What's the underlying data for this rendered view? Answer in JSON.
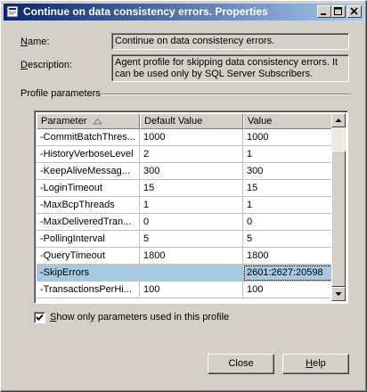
{
  "window": {
    "title": "Continue on data consistency errors. Properties"
  },
  "name": {
    "label_prefix": "N",
    "label_rest": "ame:",
    "value": "Continue on data consistency errors."
  },
  "description": {
    "label_prefix": "D",
    "label_rest": "escription:",
    "value": "Agent profile for skipping data consistency errors. It can be used only by SQL Server Subscribers."
  },
  "profile_parameters": {
    "group_label": "Profile parameters",
    "columns": {
      "parameter": "Parameter",
      "default_value": "Default Value",
      "value": "Value"
    },
    "rows": [
      {
        "parameter": "-CommitBatchThres...",
        "default": "1000",
        "value": "1000"
      },
      {
        "parameter": "-HistoryVerboseLevel",
        "default": "2",
        "value": "1"
      },
      {
        "parameter": "-KeepAliveMessag...",
        "default": "300",
        "value": "300"
      },
      {
        "parameter": "-LoginTimeout",
        "default": "15",
        "value": "15"
      },
      {
        "parameter": "-MaxBcpThreads",
        "default": "1",
        "value": "1"
      },
      {
        "parameter": "-MaxDeliveredTran...",
        "default": "0",
        "value": "0"
      },
      {
        "parameter": "-PollingInterval",
        "default": "5",
        "value": "5"
      },
      {
        "parameter": "-QueryTimeout",
        "default": "1800",
        "value": "1800"
      },
      {
        "parameter": "-SkipErrors",
        "default": "",
        "value": "2601:2627:20598"
      },
      {
        "parameter": "-TransactionsPerHi...",
        "default": "100",
        "value": "100"
      }
    ]
  },
  "show_only": {
    "label_prefix": "S",
    "label_rest": "how only parameters used in this profile",
    "checked": true
  },
  "buttons": {
    "close": "Close",
    "help_prefix": "H",
    "help_rest": "elp"
  },
  "colors": {
    "selection": "#a6c9e2",
    "title_start": "#0a246a",
    "title_end": "#a6caf0"
  }
}
